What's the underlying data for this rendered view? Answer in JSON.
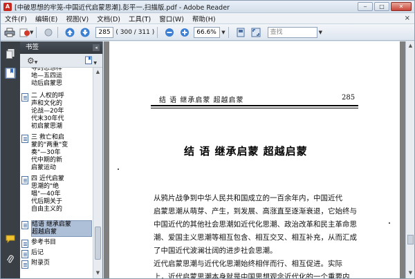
{
  "window": {
    "title": "[中破思想的牢笼-中国近代启蒙思潮].彭平一.扫描版.pdf - Adobe Reader",
    "app_icon_letter": "A",
    "buttons": {
      "minimize": "‒",
      "maximize": "□",
      "close": "✕"
    }
  },
  "menu": {
    "items": [
      "文件(F)",
      "编辑(E)",
      "视图(V)",
      "文档(D)",
      "工具(T)",
      "窗口(W)",
      "帮助(H)"
    ],
    "close_glyph": "×"
  },
  "toolbar": {
    "page_number": "285",
    "page_total": "( 300 / 311 )",
    "zoom": "66.6%",
    "search_placeholder": "查找",
    "icons": [
      "print-icon",
      "share-icon",
      "hand-icon",
      "prev-page-icon",
      "next-page-icon",
      "zoom-out-icon",
      "zoom-in-icon",
      "fit-page-icon",
      "full-screen-icon"
    ]
  },
  "rail": {
    "icons": [
      "pages-icon",
      "bookmarks-icon",
      "comments-icon",
      "attachments-icon"
    ]
  },
  "panel": {
    "title": "书签",
    "collapse_glyph": "◂",
    "bookmarks": [
      {
        "text": "寻的思想样\n地—五四运\n动后启蒙思",
        "has_icon": false,
        "selected": false
      },
      {
        "text": "二 人权的呼\n声和文化的\n论战—20年\n代末30年代\n初启蒙思潮",
        "has_icon": true,
        "selected": false
      },
      {
        "text": "三 救亡和启\n蒙的\"两重\"变\n奏\"—30年\n代中期的新\n启蒙运动",
        "has_icon": true,
        "selected": false
      },
      {
        "text": "四 近代启蒙\n思潮的\"绝\n唱\"—40年\n代后期关于\n自由主义的",
        "has_icon": true,
        "selected": false
      },
      {
        "text": "结语 继承启蒙\n超越启蒙",
        "has_icon": true,
        "selected": true
      },
      {
        "text": "参考书目",
        "has_icon": true,
        "selected": false
      },
      {
        "text": "后记",
        "has_icon": true,
        "selected": false
      },
      {
        "text": "附录页",
        "has_icon": true,
        "selected": false
      }
    ]
  },
  "document": {
    "running_head": "结 语  继承启蒙  超越启蒙",
    "running_page": "285",
    "chapter_title": "结  语   继承启蒙   超越启蒙",
    "paragraph1": [
      "    从鸦片战争到中华人民共和国成立的一百余年内，中国近代",
      "启蒙思潮从萌芽、产生，到发展、高涨直至逐渐衰退，它始终与",
      "中国近代的其他社会思潮如近代化思潮、政治改革和民主革命思",
      "潮、爱国主义思潮等相互包含、相互交叉、相互补充，从而汇成",
      "了中国近代波澜壮阔的进步社会思潮。"
    ],
    "paragraph2": [
      "    近代启蒙思潮与近代化思潮始终相伴而行、相互促进。实际",
      "上，近代启蒙思潮本身就是中国思想观念近代化的一个重要内"
    ]
  }
}
